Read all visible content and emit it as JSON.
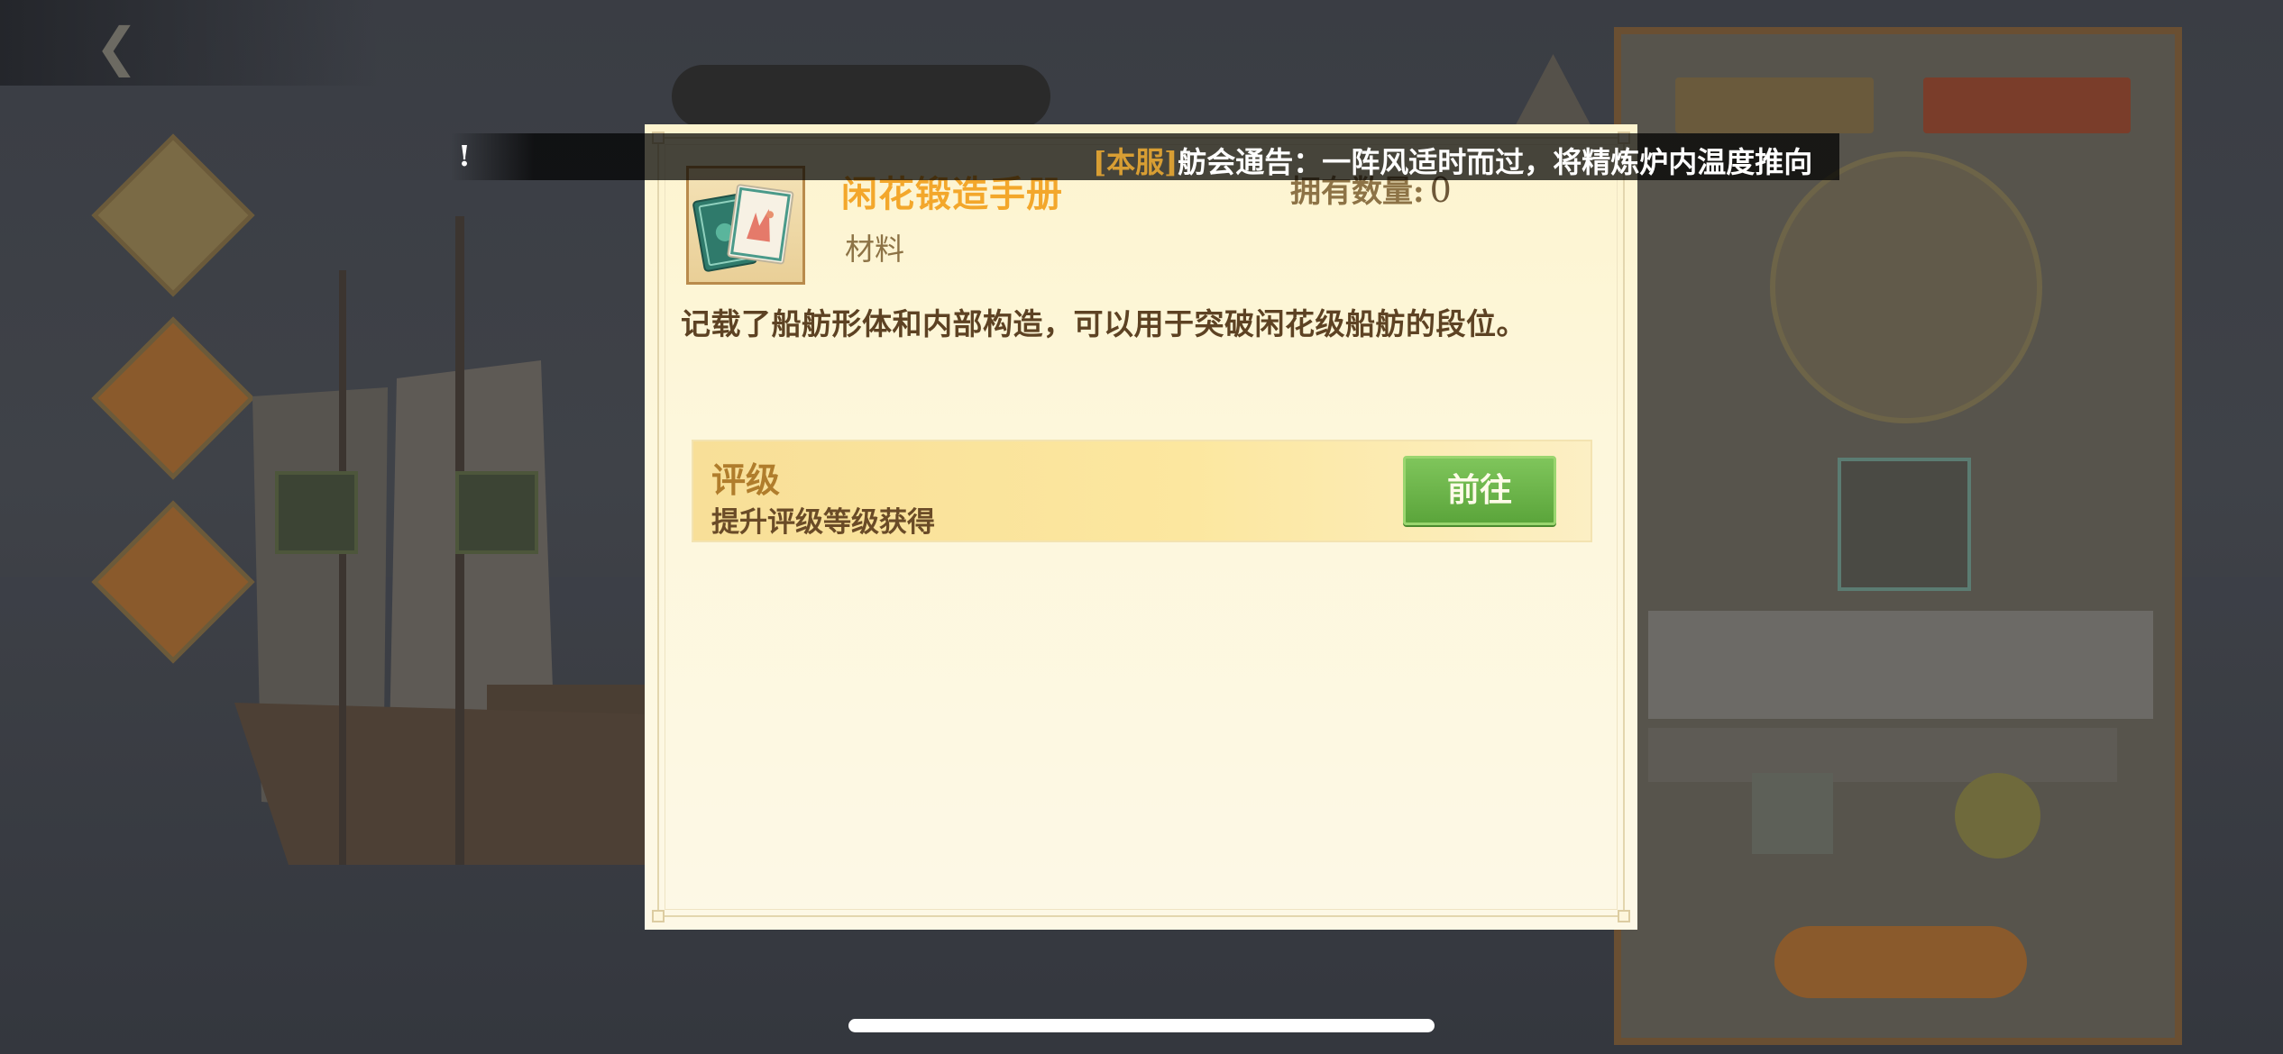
{
  "ticker": {
    "prefix": "!",
    "tag": "[本服]",
    "message": "舫会通告：一阵风适时而过，将精炼炉内温度推向"
  },
  "item": {
    "name": "闲花锻造手册",
    "type": "材料",
    "owned_label": "拥有数量:",
    "owned_count": "0",
    "description": "记载了船舫形体和内部构造，可以用于突破闲花级船舫的段位。",
    "icon": "book-icon"
  },
  "source": {
    "title": "评级",
    "description": "提升评级等级获得",
    "button_label": "前往"
  },
  "colors": {
    "item_name": "#f3a72b",
    "ticker_tag": "#d89e33",
    "goto_button": "#6bb349"
  }
}
